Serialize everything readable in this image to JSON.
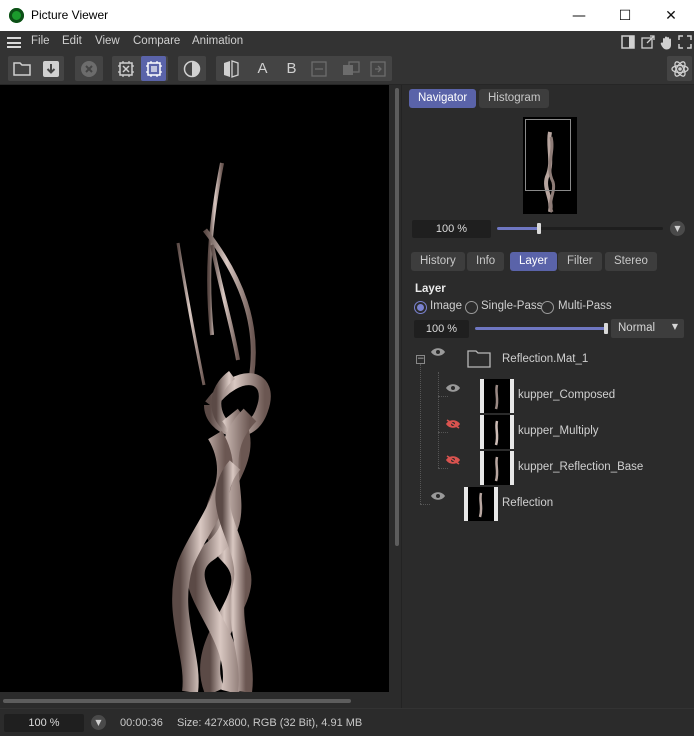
{
  "window": {
    "title": "Picture Viewer",
    "minimize": "—",
    "maximize": "☐",
    "close": "✕"
  },
  "menu": {
    "items": [
      "File",
      "Edit",
      "View",
      "Compare",
      "Animation"
    ]
  },
  "toolbar": {
    "text_a": "A",
    "text_b": "B"
  },
  "panel_tabs": {
    "navigator": "Navigator",
    "histogram": "Histogram"
  },
  "navigator": {
    "zoom": "100 %",
    "zoom_fraction": 0.25
  },
  "sub_tabs": {
    "history": "History",
    "info": "Info",
    "layer": "Layer",
    "filter": "Filter",
    "stereo": "Stereo",
    "active": "Layer"
  },
  "layer": {
    "section_title": "Layer",
    "modes": {
      "image": "Image",
      "single_pass": "Single-Pass",
      "multi_pass": "Multi-Pass",
      "selected": "Image"
    },
    "opacity": "100 %",
    "opacity_fraction": 1.0,
    "blend_mode": "Normal",
    "tree": {
      "folder": "Reflection.Mat_1",
      "children": [
        {
          "name": "kupper_Composed",
          "visible": true
        },
        {
          "name": "kupper_Multiply",
          "visible": false
        },
        {
          "name": "kupper_Reflection_Base",
          "visible": false
        }
      ],
      "root_layer": "Reflection"
    }
  },
  "status": {
    "zoom": "100 %",
    "time": "00:00:36",
    "info": "Size: 427x800, RGB (32 Bit), 4.91 MB"
  },
  "colors": {
    "accent": "#5a63a9",
    "hidden_eye": "#d9534f",
    "eye": "#9a9a9a",
    "background": "#2b2b2b"
  }
}
